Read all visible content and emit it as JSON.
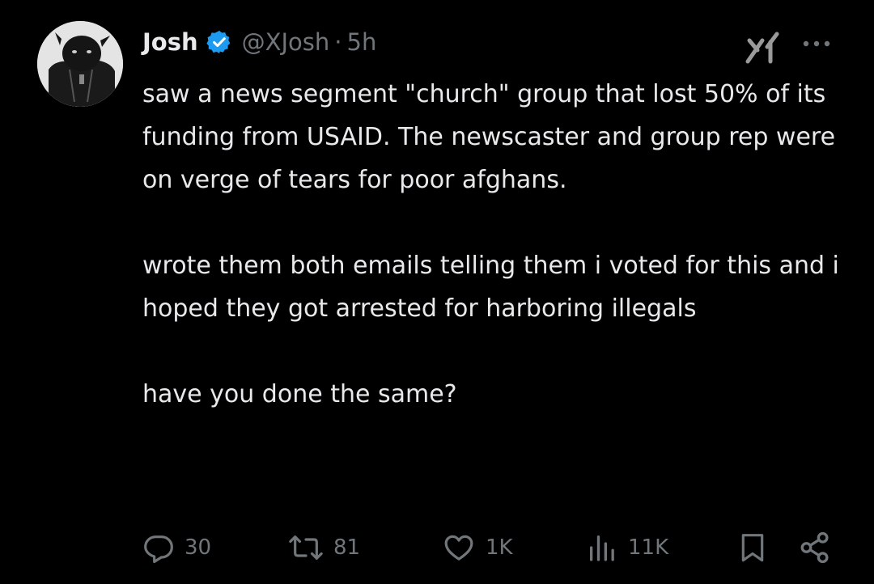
{
  "post": {
    "author": {
      "display_name": "Josh",
      "handle": "@XJosh",
      "separator": "·",
      "time": "5h",
      "verified_color": "#1d9bf0"
    },
    "paragraphs": [
      "saw a news segment \"church\" group that lost 50% of its funding from USAID. The newscaster and group rep were on verge of tears for poor afghans.",
      "wrote them both emails telling them i voted for this and i hoped they got arrested for harboring illegals",
      "have you done the same?"
    ],
    "actions": {
      "replies": "30",
      "reposts": "81",
      "likes": "1K",
      "views": "11K"
    },
    "icons": {
      "grok": "grok-icon",
      "more": "more-icon",
      "reply": "reply-icon",
      "repost": "repost-icon",
      "like": "heart-icon",
      "views": "views-icon",
      "bookmark": "bookmark-icon",
      "share": "share-icon"
    }
  }
}
